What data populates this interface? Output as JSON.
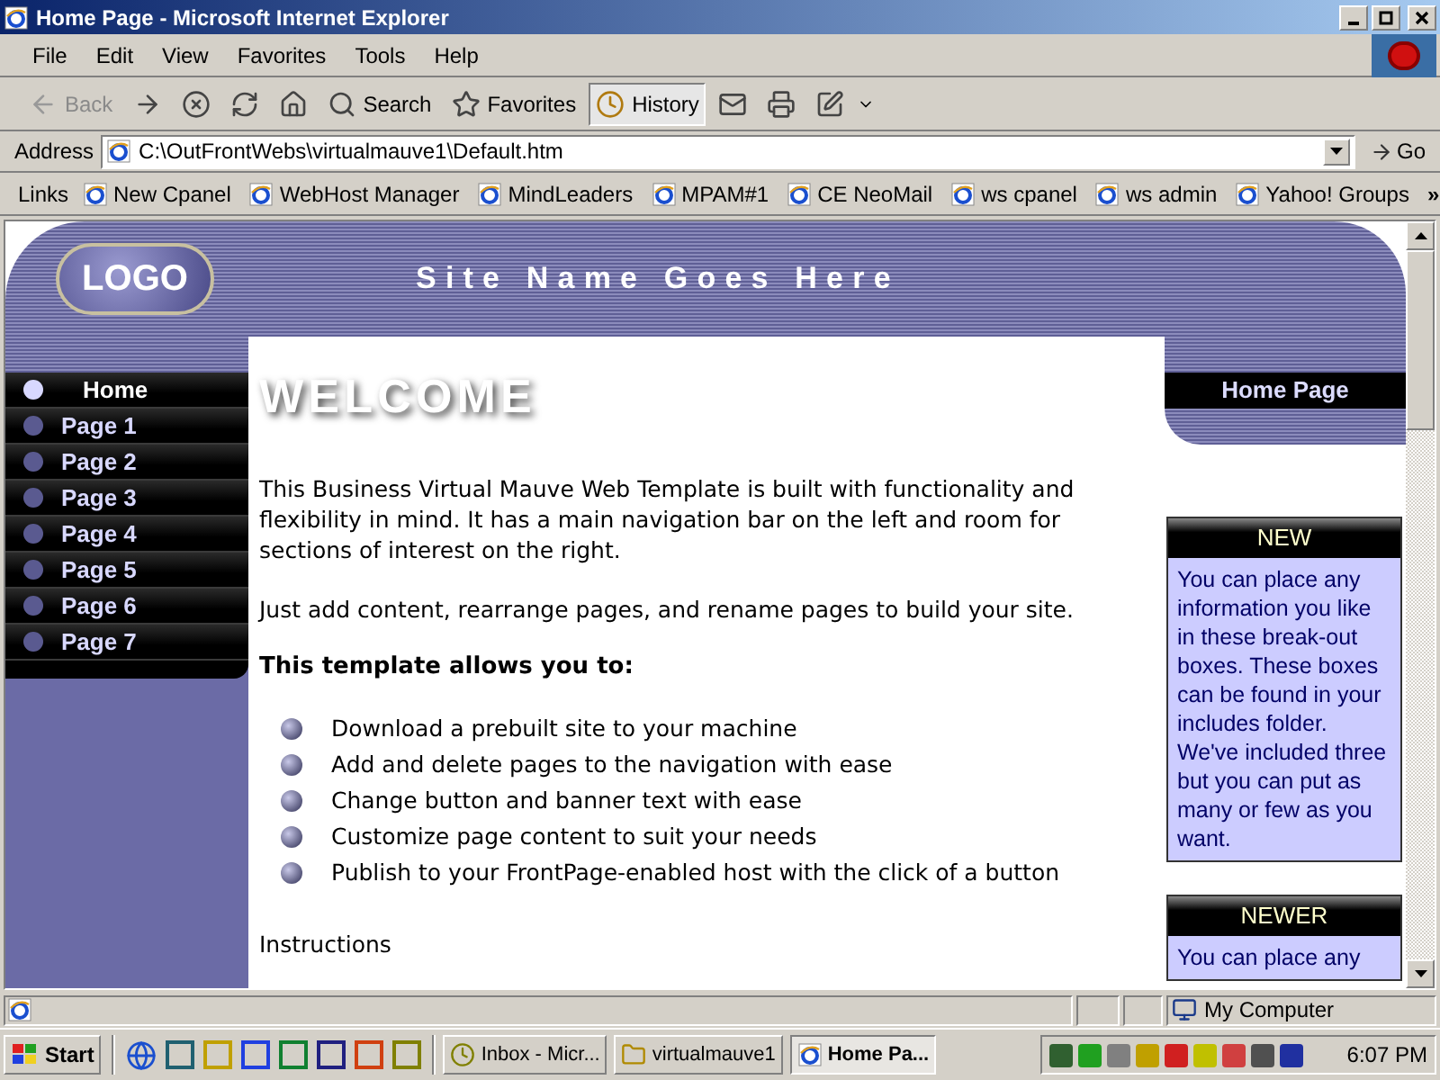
{
  "window": {
    "title": "Home Page - Microsoft Internet Explorer"
  },
  "menu": [
    "File",
    "Edit",
    "View",
    "Favorites",
    "Tools",
    "Help"
  ],
  "toolbar": [
    {
      "kind": "back",
      "label": "Back",
      "disabled": true
    },
    {
      "kind": "forward",
      "disabled": false
    },
    {
      "kind": "stop"
    },
    {
      "kind": "refresh"
    },
    {
      "kind": "home"
    },
    {
      "kind": "search",
      "label": "Search",
      "pressed": false
    },
    {
      "kind": "favorites",
      "label": "Favorites",
      "pressed": false
    },
    {
      "kind": "history",
      "label": "History",
      "pressed": true
    },
    {
      "kind": "mail"
    },
    {
      "kind": "print"
    },
    {
      "kind": "edit"
    }
  ],
  "address": {
    "label": "Address",
    "value": "C:\\OutFrontWebs\\virtualmauve1\\Default.htm",
    "go": "Go"
  },
  "links": {
    "label": "Links",
    "items": [
      "New Cpanel",
      "WebHost Manager",
      "MindLeaders",
      "MPAM#1",
      "CE NeoMail",
      "ws cpanel",
      "ws admin",
      "Yahoo! Groups"
    ],
    "more": "»"
  },
  "page": {
    "logo": "LOGO",
    "site_name": "Site Name Goes Here",
    "nav": [
      {
        "label": "Home",
        "selected": true
      },
      {
        "label": "Page 1",
        "selected": false
      },
      {
        "label": "Page 2",
        "selected": false
      },
      {
        "label": "Page 3",
        "selected": false
      },
      {
        "label": "Page 4",
        "selected": false
      },
      {
        "label": "Page 5",
        "selected": false
      },
      {
        "label": "Page 6",
        "selected": false
      },
      {
        "label": "Page 7",
        "selected": false
      }
    ],
    "heading": "WELCOME",
    "paragraphs": [
      "This Business Virtual Mauve Web Template is built with functionality and flexibility in mind.  It has a main navigation bar on the left and room for sections of interest on the right.",
      "Just add content, rearrange pages, and rename pages to build your site."
    ],
    "subheading": "This template allows you to:",
    "bullets": [
      "Download a prebuilt site to your machine",
      "Add and delete pages to the navigation with ease",
      "Change button and banner text with ease",
      "Customize page content to suit your needs",
      "Publish to your FrontPage-enabled host with the click of a button"
    ],
    "instructions": "Instructions",
    "page_label": "Home Page",
    "boxes": [
      {
        "title": "NEW",
        "body": "You can place any information you like in these break-out boxes. These boxes can be found in your includes folder. We've included three but you can put as many or few as you want."
      },
      {
        "title": "NEWER",
        "body": "You can place any"
      }
    ]
  },
  "status_bar": {
    "zone": "My Computer"
  },
  "taskbar": {
    "start": "Start",
    "tasks": [
      {
        "label": "Inbox - Micr...",
        "selected": false
      },
      {
        "label": "virtualmauve1",
        "selected": false
      },
      {
        "label": "Home Pa...",
        "selected": true
      }
    ],
    "clock": "6:07 PM"
  }
}
